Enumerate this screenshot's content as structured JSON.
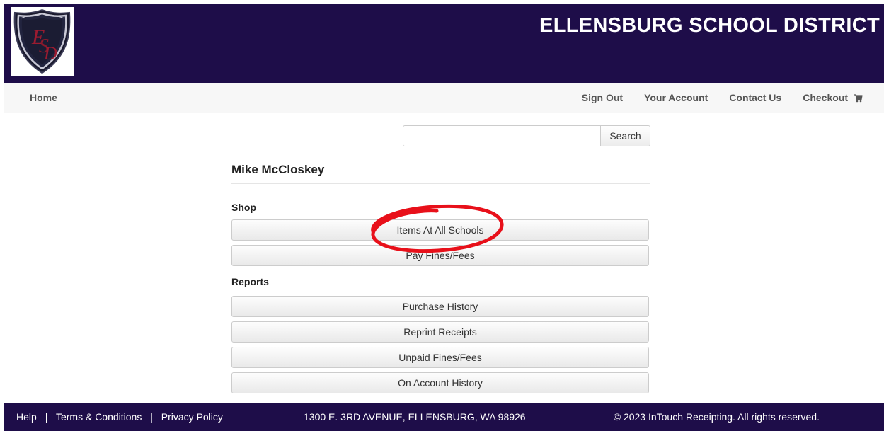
{
  "header": {
    "title": "ELLENSBURG SCHOOL DISTRICT",
    "logo_icon": "esd-shield-logo",
    "background_color": "#1e0d49"
  },
  "nav": {
    "home": "Home",
    "sign_out": "Sign Out",
    "your_account": "Your Account",
    "contact_us": "Contact Us",
    "checkout": "Checkout",
    "checkout_icon": "cart-icon"
  },
  "search": {
    "value": "",
    "placeholder": "",
    "button_label": "Search"
  },
  "user": {
    "name": "Mike McCloskey"
  },
  "shop": {
    "heading": "Shop",
    "items": [
      {
        "label": "Items At All Schools"
      },
      {
        "label": "Pay Fines/Fees"
      }
    ]
  },
  "reports": {
    "heading": "Reports",
    "items": [
      {
        "label": "Purchase History"
      },
      {
        "label": "Reprint Receipts"
      },
      {
        "label": "Unpaid Fines/Fees"
      },
      {
        "label": "On Account History"
      }
    ]
  },
  "footer": {
    "help": "Help",
    "separator": "|",
    "terms": "Terms & Conditions",
    "privacy": "Privacy Policy",
    "address": "1300 E. 3RD AVENUE, ELLENSBURG, WA 98926",
    "copyright": "© 2023 InTouch Receipting. All rights reserved."
  },
  "annotation": {
    "color": "#e8101a"
  }
}
